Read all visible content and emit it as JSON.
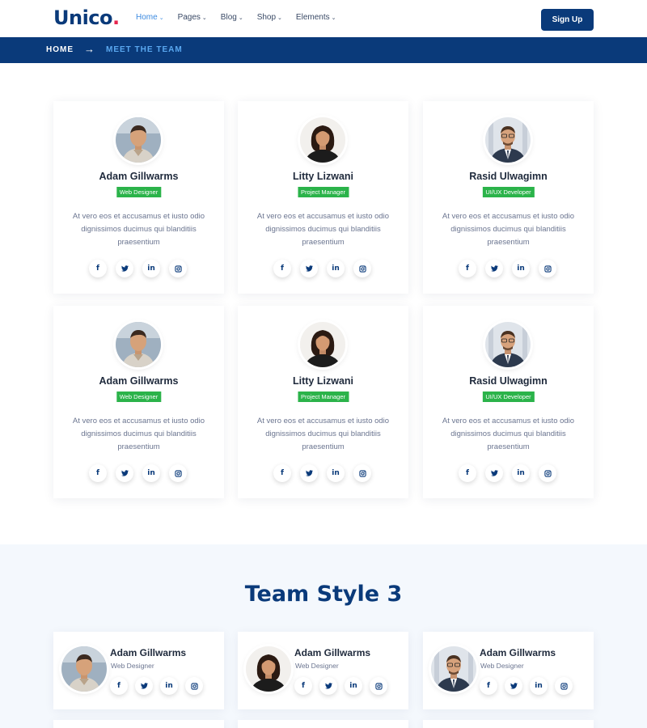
{
  "header": {
    "logo_text": "Unico",
    "logo_dot": ".",
    "nav": [
      {
        "label": "Home",
        "active": true
      },
      {
        "label": "Pages",
        "active": false
      },
      {
        "label": "Blog",
        "active": false
      },
      {
        "label": "Shop",
        "active": false
      },
      {
        "label": "Elements",
        "active": false
      }
    ],
    "chevron": "⌄",
    "signup_label": "Sign Up"
  },
  "breadcrumb": {
    "home": "HOME",
    "arrow": "→",
    "current": "MEET THE TEAM"
  },
  "team": [
    {
      "name": "Adam Gillwarms",
      "role": "Web Designer",
      "text": "At vero eos et accusamus et iusto odio dignissimos ducimus qui blanditiis praesentium"
    },
    {
      "name": "Litty Lizwani",
      "role": "Project Manager",
      "text": "At vero eos et accusamus et iusto odio dignissimos ducimus qui blanditiis praesentium"
    },
    {
      "name": "Rasid Ulwagimn",
      "role": "UI/UX Developer",
      "text": "At vero eos et accusamus et iusto odio dignissimos ducimus qui blanditiis praesentium"
    },
    {
      "name": "Adam Gillwarms",
      "role": "Web Designer",
      "text": "At vero eos et accusamus et iusto odio dignissimos ducimus qui blanditiis praesentium"
    },
    {
      "name": "Litty Lizwani",
      "role": "Project Manager",
      "text": "At vero eos et accusamus et iusto odio dignissimos ducimus qui blanditiis praesentium"
    },
    {
      "name": "Rasid Ulwagimn",
      "role": "UI/UX Developer",
      "text": "At vero eos et accusamus et iusto odio dignissimos ducimus qui blanditiis praesentium"
    }
  ],
  "socials": [
    "f",
    "t",
    "in",
    "ig"
  ],
  "style3": {
    "title": "Team Style 3",
    "members": [
      {
        "name": "Adam Gillwarms",
        "role": "Web Designer"
      },
      {
        "name": "Adam Gillwarms",
        "role": "Web Designer"
      },
      {
        "name": "Adam Gillwarms",
        "role": "Web Designer"
      }
    ]
  },
  "colors": {
    "brand": "#0a3a7a",
    "accent": "#3d8be0",
    "logo_dot": "#e6254e",
    "badge": "#2bb34a"
  }
}
